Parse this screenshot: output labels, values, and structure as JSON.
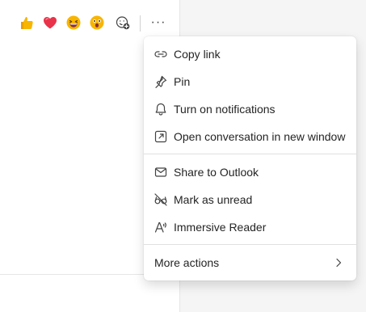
{
  "reactions": [
    {
      "name": "like",
      "icon": "thumbs-up-emoji"
    },
    {
      "name": "heart",
      "icon": "heart-emoji"
    },
    {
      "name": "laugh",
      "icon": "laughing-emoji"
    },
    {
      "name": "surprised",
      "icon": "surprised-emoji"
    },
    {
      "name": "add-reaction",
      "icon": "add-reaction-icon"
    }
  ],
  "more_button": {
    "label": "···",
    "icon": "more-options-icon"
  },
  "menu": {
    "items": [
      {
        "label": "Copy link",
        "icon": "link-icon"
      },
      {
        "label": "Pin",
        "icon": "pin-icon"
      },
      {
        "label": "Turn on notifications",
        "icon": "bell-icon"
      },
      {
        "label": "Open conversation in new window",
        "icon": "open-window-icon"
      },
      {
        "label": "Share to Outlook",
        "icon": "mail-icon"
      },
      {
        "label": "Mark as unread",
        "icon": "unread-glasses-icon"
      },
      {
        "label": "Immersive Reader",
        "icon": "immersive-reader-icon"
      }
    ],
    "more_actions": {
      "label": "More actions",
      "icon": "chevron-right-icon"
    }
  },
  "colors": {
    "menu_bg": "#ffffff",
    "text": "#242424",
    "icon": "#424242",
    "divider": "#e0e0e0",
    "emoji_yellow": "#f7b500",
    "heart_red": "#e8334a"
  }
}
